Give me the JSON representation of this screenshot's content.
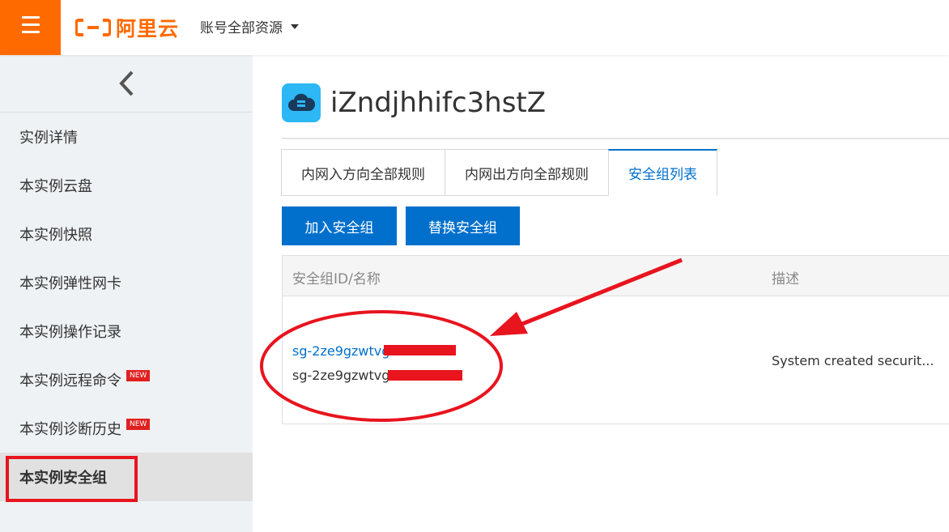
{
  "header": {
    "logo_text": "阿里云",
    "account_label": "账号全部资源",
    "brand_color": "#ff6a00"
  },
  "sidebar": {
    "items": [
      {
        "label": "实例详情"
      },
      {
        "label": "本实例云盘"
      },
      {
        "label": "本实例快照"
      },
      {
        "label": "本实例弹性网卡"
      },
      {
        "label": "本实例操作记录"
      },
      {
        "label": "本实例远程命令",
        "badge": "NEW"
      },
      {
        "label": "本实例诊断历史",
        "badge": "NEW"
      },
      {
        "label": "本实例安全组"
      }
    ]
  },
  "main": {
    "instance_title": "iZndjhhifc3hstZ",
    "tabs": [
      {
        "label": "内网入方向全部规则"
      },
      {
        "label": "内网出方向全部规则"
      },
      {
        "label": "安全组列表"
      }
    ],
    "buttons": {
      "join": "加入安全组",
      "replace": "替换安全组"
    },
    "table": {
      "headers": [
        "安全组ID/名称",
        "描述"
      ],
      "rows": [
        {
          "id": "sg-2ze9gzwtvg",
          "name": "sg-2ze9gzwtvg",
          "description": "System created securit..."
        }
      ]
    }
  },
  "colors": {
    "accent": "#0070cc",
    "annotation": "#e8141e"
  }
}
